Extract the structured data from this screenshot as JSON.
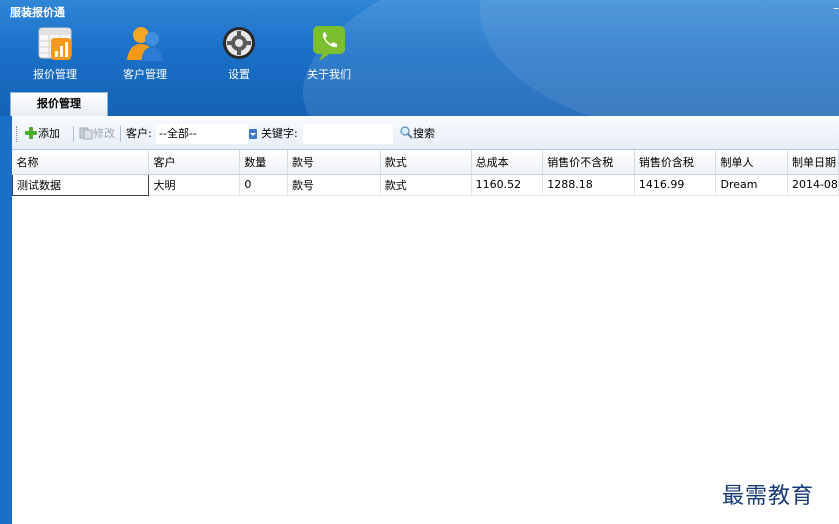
{
  "app": {
    "title": "服装报价通"
  },
  "nav": [
    {
      "label": "报价管理",
      "icon": "chart-icon"
    },
    {
      "label": "客户管理",
      "icon": "users-icon"
    },
    {
      "label": "设置",
      "icon": "gear-icon"
    },
    {
      "label": "关于我们",
      "icon": "phone-icon"
    }
  ],
  "tabs": [
    {
      "label": "报价管理"
    }
  ],
  "toolbar": {
    "add_label": "添加",
    "edit_label": "修改",
    "customer_label": "客户:",
    "customer_value": "--全部--",
    "keyword_label": "关键字:",
    "keyword_value": "",
    "search_label": "搜索"
  },
  "table": {
    "columns": [
      "名称",
      "客户",
      "数量",
      "款号",
      "款式",
      "总成本",
      "销售价不含税",
      "销售价含税",
      "制单人",
      "制单日期"
    ],
    "rows": [
      [
        "测试数据",
        "大明",
        "0",
        "款号",
        "款式",
        "1160.52",
        "1288.18",
        "1416.99",
        "Dream",
        "2014-08"
      ]
    ]
  },
  "watermark": "最需教育",
  "colors": {
    "ribbon": "#1a6fc6",
    "accent": "#2f86d6",
    "watermark": "#173c7a"
  }
}
